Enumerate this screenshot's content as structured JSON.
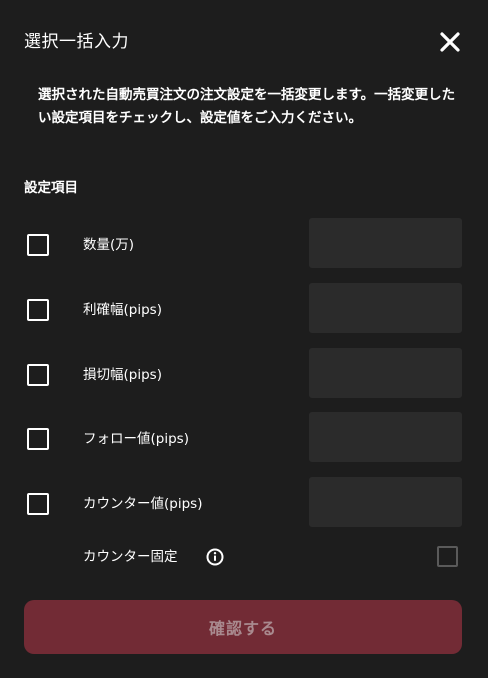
{
  "dialog": {
    "title": "選択一括入力",
    "description": "選択された自動売買注文の注文設定を一括変更します。一括変更したい設定項目をチェックし、設定値をご入力ください。",
    "section_label": "設定項目",
    "rows": [
      {
        "label": "数量(万)",
        "checked": false,
        "value": ""
      },
      {
        "label": "利確幅(pips)",
        "checked": false,
        "value": ""
      },
      {
        "label": "損切幅(pips)",
        "checked": false,
        "value": ""
      },
      {
        "label": "フォロー値(pips)",
        "checked": false,
        "value": ""
      },
      {
        "label": "カウンター値(pips)",
        "checked": false,
        "value": ""
      }
    ],
    "counter_lock": {
      "label": "カウンター固定",
      "checked": false
    },
    "confirm_label": "確認する"
  },
  "colors": {
    "background": "#1d1d1d",
    "field_background": "#2b2b2b",
    "confirm_background": "#722b35",
    "confirm_text": "#a98a8f"
  }
}
